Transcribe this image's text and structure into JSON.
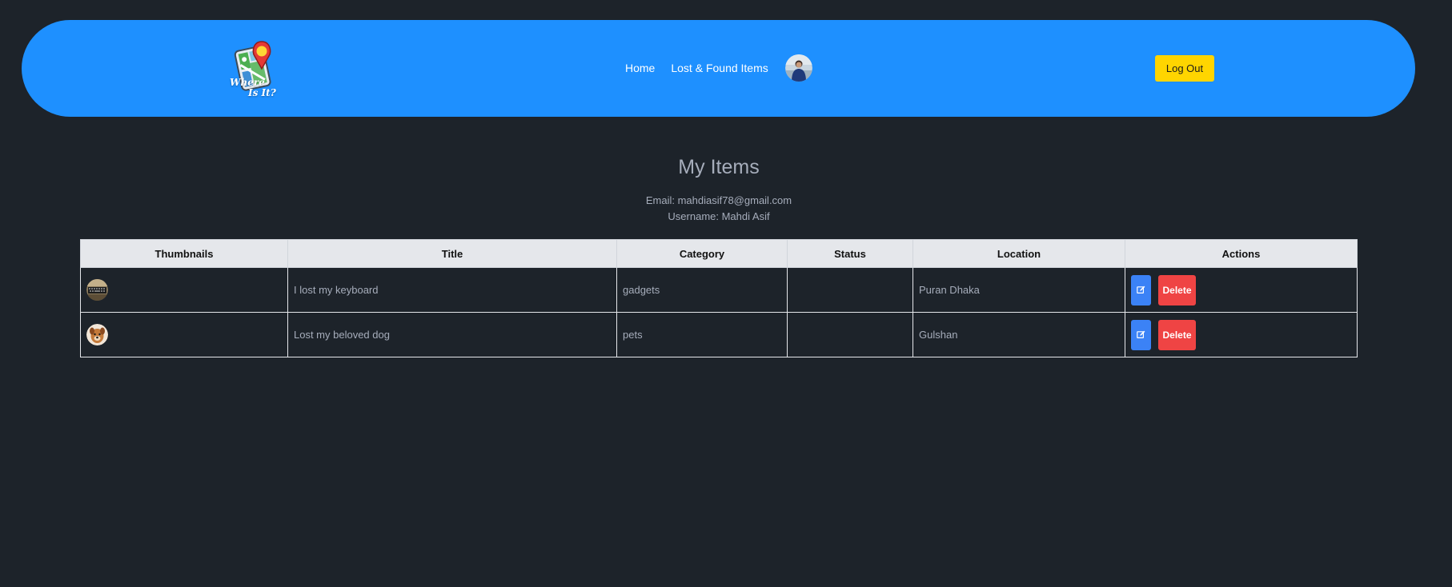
{
  "navbar": {
    "logo": {
      "line1": "Where",
      "line2": "Is It?"
    },
    "links": [
      "Home",
      "Lost & Found Items"
    ],
    "logout_label": "Log Out",
    "colors": {
      "background": "#1e90ff",
      "logout": "#ffd500"
    }
  },
  "main": {
    "title": "My Items",
    "email_line": "Email: mahdiasif78@gmail.com",
    "username_line": "Username: Mahdi Asif"
  },
  "table": {
    "headers": [
      "Thumbnails",
      "Title",
      "Category",
      "Status",
      "Location",
      "Actions"
    ],
    "rows": [
      {
        "thumbnail": "keyboard-thumbnail",
        "title": "I lost my keyboard",
        "category": "gadgets",
        "status": "",
        "location": "Puran Dhaka",
        "edit_icon": "edit-icon",
        "delete_label": "Delete"
      },
      {
        "thumbnail": "dog-thumbnail",
        "title": "Lost my beloved dog",
        "category": "pets",
        "status": "",
        "location": "Gulshan",
        "edit_icon": "edit-icon",
        "delete_label": "Delete"
      }
    ]
  },
  "colors": {
    "page_background": "#1d232a",
    "text_muted": "#a6adbb",
    "edit_button": "#3b82f6",
    "delete_button": "#ef4444",
    "table_header": "#e5e7eb"
  }
}
